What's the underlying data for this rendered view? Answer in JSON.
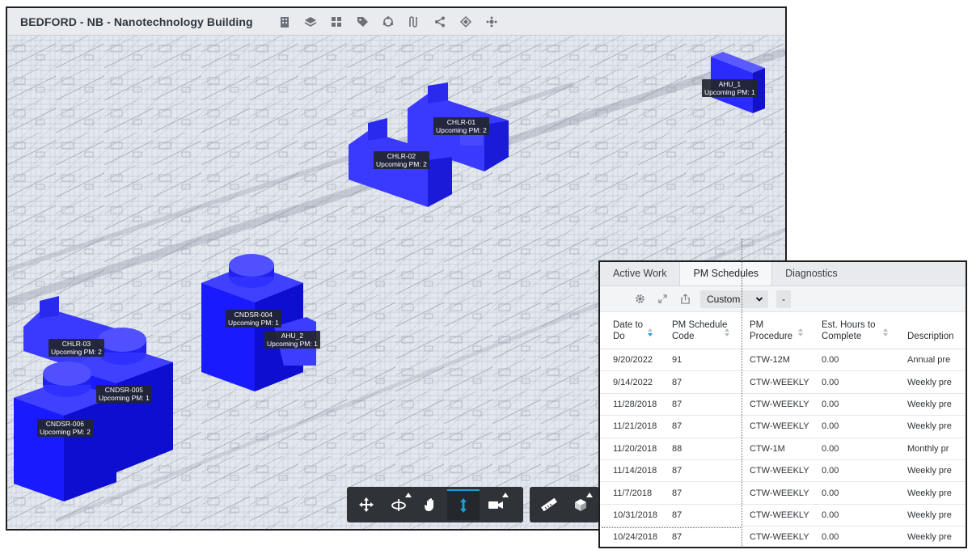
{
  "viewer": {
    "title": "BEDFORD - NB - Nanotechnology Building",
    "header_icons": [
      "building-icon",
      "layers-icon",
      "grid-icon",
      "tag-icon",
      "cycle-icon",
      "flow-icon",
      "share-icon",
      "system-icon",
      "network-icon"
    ]
  },
  "equipment": [
    {
      "name": "AHU_1",
      "pm": "Upcoming PM: 1"
    },
    {
      "name": "CHLR-01",
      "pm": "Upcoming PM: 2"
    },
    {
      "name": "CHLR-02",
      "pm": "Upcoming PM: 2"
    },
    {
      "name": "CNDSR-004",
      "pm": "Upcoming PM: 1"
    },
    {
      "name": "AHU_2",
      "pm": "Upcoming PM: 1"
    },
    {
      "name": "CHLR-03",
      "pm": "Upcoming PM: 2"
    },
    {
      "name": "CNDSR-005",
      "pm": "Upcoming PM: 1"
    },
    {
      "name": "CNDSR-006",
      "pm": "Upcoming PM: 2"
    }
  ],
  "toolbar": {
    "tools": [
      "move-icon",
      "orbit-icon",
      "pan-icon",
      "zoom-icon",
      "camera-icon"
    ],
    "tools2": [
      "measure-icon",
      "section-icon"
    ],
    "active": "zoom-icon"
  },
  "pm_panel": {
    "tabs": [
      "Active Work",
      "PM Schedules",
      "Diagnostics"
    ],
    "active_tab": "PM Schedules",
    "view_select": "Custom",
    "dash": "-",
    "columns": [
      {
        "line1": "Date to",
        "line2": "Do"
      },
      {
        "line1": "PM Schedule",
        "line2": "Code"
      },
      {
        "line1": "PM",
        "line2": "Procedure"
      },
      {
        "line1": "Est. Hours to",
        "line2": "Complete"
      },
      {
        "line1": "Description",
        "line2": ""
      }
    ],
    "rows": [
      [
        "9/20/2022",
        "91",
        "CTW-12M",
        "0.00",
        "Annual pre"
      ],
      [
        "9/14/2022",
        "87",
        "CTW-WEEKLY",
        "0.00",
        "Weekly pre"
      ],
      [
        "11/28/2018",
        "87",
        "CTW-WEEKLY",
        "0.00",
        "Weekly pre"
      ],
      [
        "11/21/2018",
        "87",
        "CTW-WEEKLY",
        "0.00",
        "Weekly pre"
      ],
      [
        "11/20/2018",
        "88",
        "CTW-1M",
        "0.00",
        "Monthly pr"
      ],
      [
        "11/14/2018",
        "87",
        "CTW-WEEKLY",
        "0.00",
        "Weekly pre"
      ],
      [
        "11/7/2018",
        "87",
        "CTW-WEEKLY",
        "0.00",
        "Weekly pre"
      ],
      [
        "10/31/2018",
        "87",
        "CTW-WEEKLY",
        "0.00",
        "Weekly pre"
      ],
      [
        "10/24/2018",
        "87",
        "CTW-WEEKLY",
        "0.00",
        "Weekly pre"
      ]
    ]
  },
  "colors": {
    "equipment_blue": "#1a1aff",
    "active_accent": "#1c9ed8",
    "toolbar_bg": "#2f3338"
  }
}
